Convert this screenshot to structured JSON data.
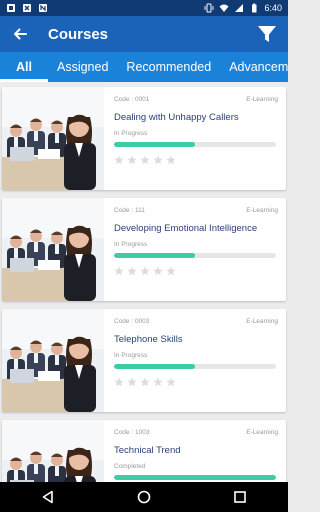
{
  "statusbar": {
    "time": "6:40"
  },
  "appbar": {
    "title": "Courses"
  },
  "tabs": [
    {
      "label": "All",
      "active": true
    },
    {
      "label": "Assigned",
      "active": false
    },
    {
      "label": "Recommended",
      "active": false
    },
    {
      "label": "Advancement",
      "active": false
    }
  ],
  "courses": [
    {
      "code": "Code : 0001",
      "type": "E-Learning",
      "title": "Dealing with Unhappy Callers",
      "status": "In Progress",
      "progress": 0.5,
      "rating": 0
    },
    {
      "code": "Code : 111",
      "type": "E-Learning",
      "title": "Developing Emotional Intelligence",
      "status": "In Progress",
      "progress": 0.5,
      "rating": 0
    },
    {
      "code": "Code : 0003",
      "type": "E-Learning",
      "title": "Telephone Skills",
      "status": "In Progress",
      "progress": 0.5,
      "rating": 0
    },
    {
      "code": "Code : 1003",
      "type": "E-Learning",
      "title": "Technical Trend",
      "status": "Completed",
      "progress": 1.0,
      "rating": 0
    }
  ],
  "colors": {
    "statusbar": "#0f3a73",
    "appbar": "#1a63b8",
    "tabs": "#1a82d9",
    "progress": "#3ecca6",
    "title": "#2a3f78"
  }
}
